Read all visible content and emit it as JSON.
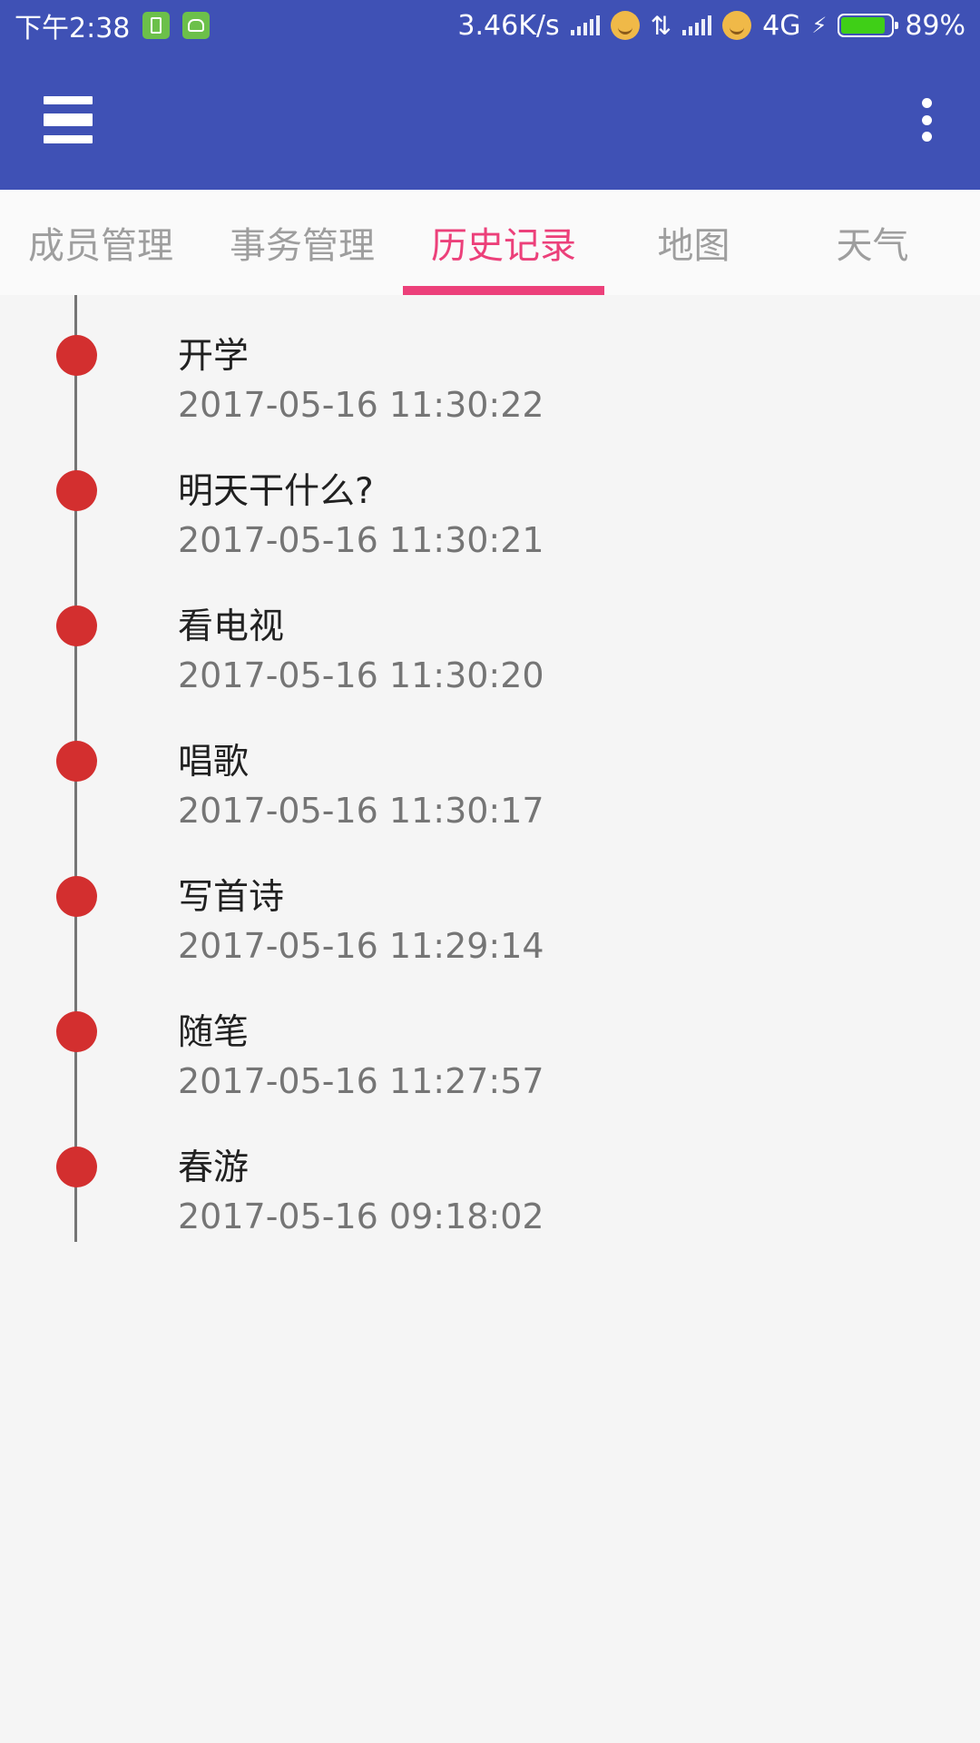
{
  "status_bar": {
    "time": "下午2:38",
    "net_speed": "3.46K/s",
    "network_type": "4G",
    "battery_percent": "89%",
    "battery_level": 0.89,
    "colors": {
      "background": "#3f51b5",
      "battery_fill": "#3fcf17",
      "badge": "#6cc04a"
    }
  },
  "app_bar": {
    "menu_icon": "menu-icon",
    "overflow_icon": "more-vert-icon",
    "color": "#3f51b5"
  },
  "tabs": {
    "items": [
      {
        "label": "成员管理",
        "active": false
      },
      {
        "label": "事务管理",
        "active": false
      },
      {
        "label": "历史记录",
        "active": true
      },
      {
        "label": "地图",
        "active": false
      },
      {
        "label": "天气",
        "active": false
      }
    ],
    "active_color": "#ec407a",
    "inactive_color": "#9e9e9e"
  },
  "history": {
    "dot_color": "#d32f2f",
    "items": [
      {
        "title": "开学",
        "time": "2017-05-16 11:30:22"
      },
      {
        "title": "明天干什么?",
        "time": "2017-05-16 11:30:21"
      },
      {
        "title": "看电视",
        "time": "2017-05-16 11:30:20"
      },
      {
        "title": "唱歌",
        "time": "2017-05-16 11:30:17"
      },
      {
        "title": "写首诗",
        "time": "2017-05-16 11:29:14"
      },
      {
        "title": "随笔",
        "time": "2017-05-16 11:27:57"
      },
      {
        "title": "春游",
        "time": "2017-05-16 09:18:02"
      }
    ]
  }
}
